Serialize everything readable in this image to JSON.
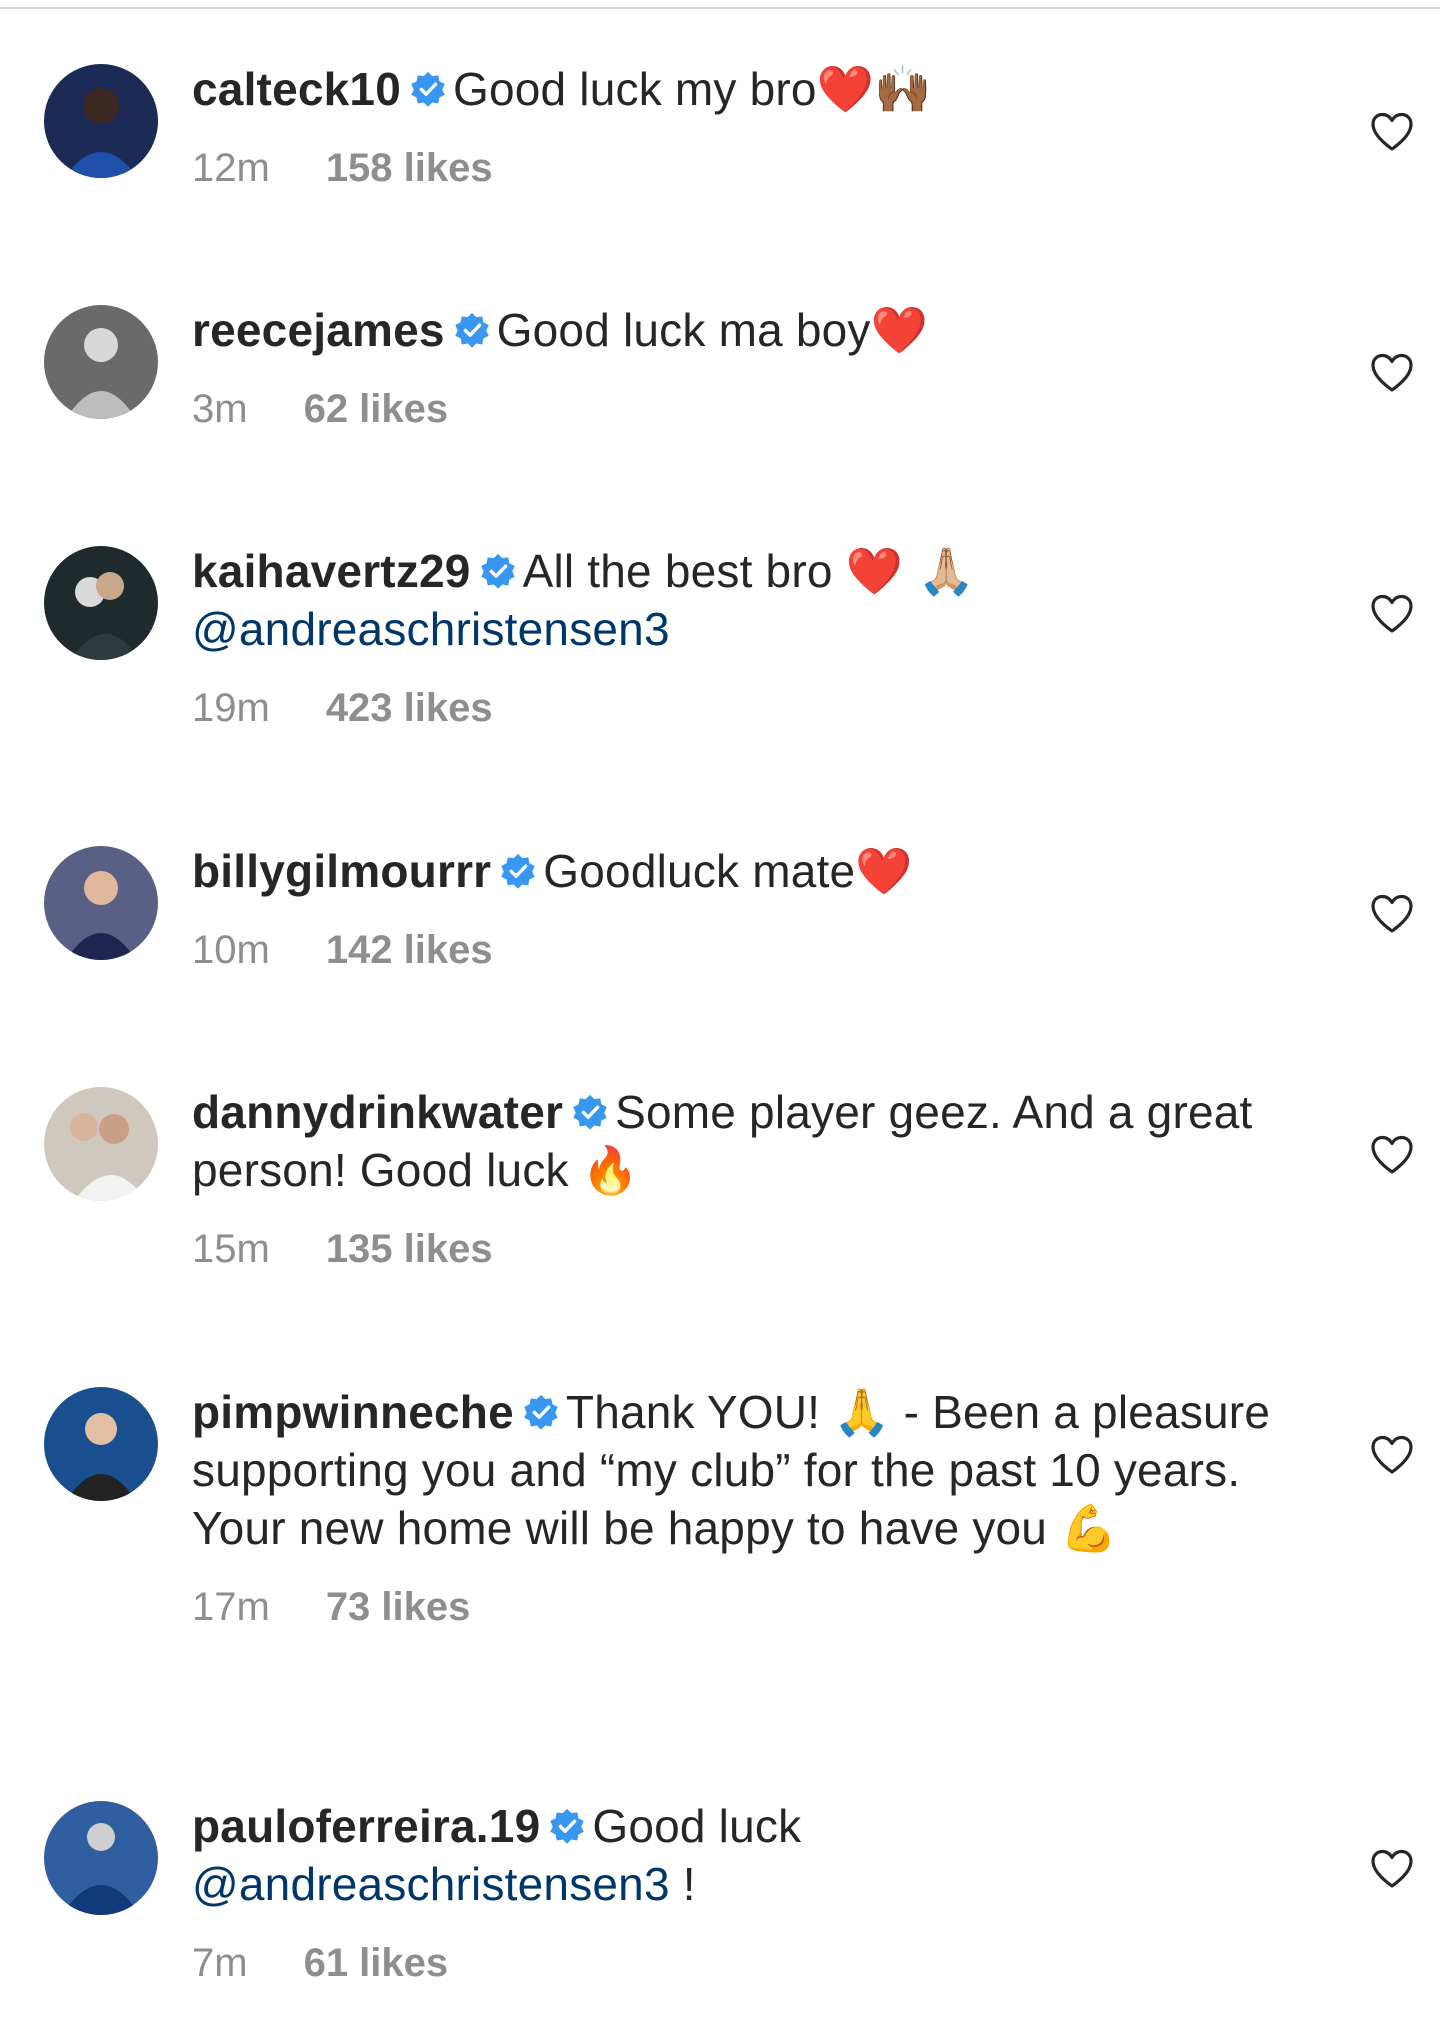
{
  "comments": [
    {
      "username": "calteck10",
      "text": "Good luck my bro",
      "emoji": "❤️🙌🏾",
      "mention": "",
      "suffix": "",
      "time": "12m",
      "likes": "158 likes"
    },
    {
      "username": "reecejames",
      "text": "Good luck ma boy",
      "emoji": "❤️",
      "mention": "",
      "suffix": "",
      "time": "3m",
      "likes": "62 likes"
    },
    {
      "username": "kaihavertz29",
      "text": "All the best bro ",
      "emoji": "❤️ 🙏🏼",
      "mention": "@andreaschristensen3",
      "suffix": "",
      "time": "19m",
      "likes": "423 likes"
    },
    {
      "username": "billygilmourrr",
      "text": "Goodluck mate",
      "emoji": "❤️",
      "mention": "",
      "suffix": "",
      "time": "10m",
      "likes": "142 likes"
    },
    {
      "username": "dannydrinkwater",
      "text": "Some player geez. And a great person! Good luck ",
      "emoji": "🔥",
      "mention": "",
      "suffix": "",
      "time": "15m",
      "likes": "135 likes"
    },
    {
      "username": "pimpwinneche",
      "text": "Thank YOU! 🙏 - Been a pleasure supporting you and “my club” for the past 10 years. Your new home will be happy to have you ",
      "emoji": "💪",
      "mention": "",
      "suffix": "",
      "time": "17m",
      "likes": "73 likes"
    },
    {
      "username": "pauloferreira.19",
      "text": "Good luck ",
      "emoji": "",
      "mention": "@andreaschristensen3",
      "suffix": " !",
      "time": "7m",
      "likes": "61 likes"
    }
  ],
  "icons": {
    "verified": "verified-badge-icon",
    "like": "heart-outline-icon"
  },
  "colors": {
    "verified": "#3897f0",
    "mention": "#00376b",
    "meta": "#8e8e8e"
  }
}
